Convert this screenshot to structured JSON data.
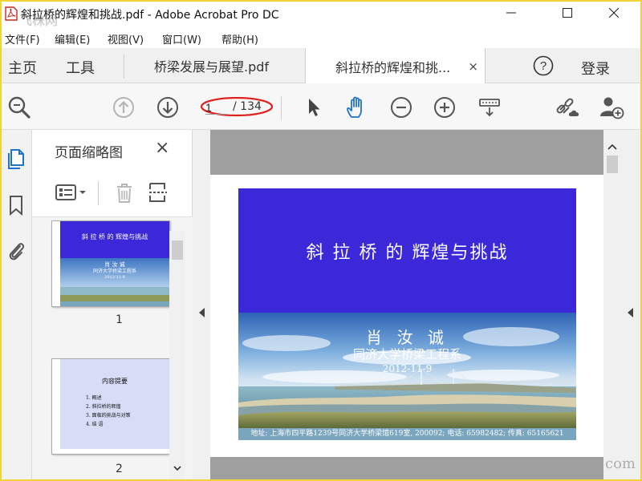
{
  "window": {
    "title": "斜拉桥的辉煌和挑战.pdf - Adobe Acrobat Pro DC"
  },
  "menu": [
    "文件(F)",
    "编辑(E)",
    "视图(V)",
    "窗口(W)",
    "帮助(H)"
  ],
  "nav": {
    "home": "主页",
    "tools": "工具"
  },
  "tabs": [
    {
      "label": "桥梁发展与展望.pdf",
      "active": false
    },
    {
      "label": "斜拉桥的辉煌和挑...",
      "active": true,
      "close": "×"
    }
  ],
  "account": {
    "help": "?",
    "login": "登录"
  },
  "toolbar": {
    "current_page": "1",
    "total_pages": "/ 134",
    "icons": [
      "zoom-search-icon",
      "page-up-icon",
      "page-down-icon",
      "select-arrow-icon",
      "hand-icon",
      "zoom-out-icon",
      "zoom-in-icon",
      "page-display-icon",
      "share-link-icon",
      "add-person-icon"
    ],
    "highlight_color": "#e0201f"
  },
  "sidebar_rail": [
    "page-thumbnails-icon",
    "bookmark-icon",
    "attachment-icon"
  ],
  "thumbnails_panel": {
    "title": "页面缩略图",
    "close": "×",
    "thumbs": [
      {
        "page": "1",
        "title": "斜 拉 桥 的 辉煌与挑战",
        "author": "肖 汝 诚",
        "org": "同济大学桥梁工程系",
        "date": "2012-11-9"
      },
      {
        "page": "2",
        "title": "内容提要",
        "items": [
          "1. 概述",
          "2. 斜拉桥的辉煌",
          "3. 面临的挑战与对策",
          "4. 结 语"
        ]
      }
    ]
  },
  "slide": {
    "title": "斜 拉 桥 的 辉煌与挑战",
    "author": "肖 汝 诚",
    "org": "同济大学桥梁工程系",
    "date": "2012-11-9",
    "footer": "地址: 上海市四平路1239号同济大学桥梁馆619室, 200092; 电话: 65982482; 传真: 65165621",
    "colors": {
      "header": "#3b28d8",
      "footer": "#7aa5bf"
    }
  },
  "watermark": {
    "top_left": "飞株网",
    "bottom_right": "com"
  }
}
